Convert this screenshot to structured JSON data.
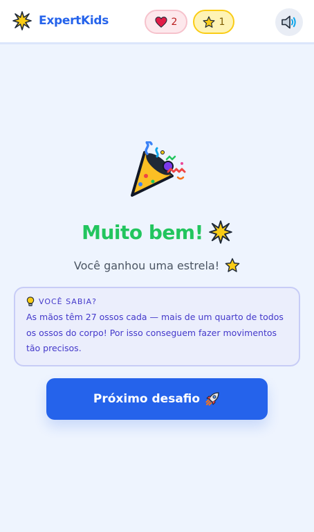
{
  "header": {
    "brand_name": "ExpertKids",
    "lives_count": "2",
    "stars_count": "1",
    "brand_icon": "sparkle-icon",
    "lives_icon": "heart-icon",
    "stars_icon": "star-icon",
    "sound_icon": "speaker-icon"
  },
  "result": {
    "icon": "party-popper-icon",
    "title": "Muito bem!",
    "subtitle": "Você ganhou uma estrela!"
  },
  "fact": {
    "heading": "VOCÊ SABIA?",
    "icon": "lightbulb-icon",
    "text": "As mãos têm 27 ossos cada — mais de um quarto de todos os ossos do corpo! Por isso conseguem fazer movimentos tão precisos."
  },
  "actions": {
    "next_label": "Próximo desafio",
    "next_icon": "rocket-icon"
  },
  "colors": {
    "brand": "#2563eb",
    "success": "#22c55e",
    "background": "#eef4fe",
    "fact_text": "#4338ca"
  }
}
